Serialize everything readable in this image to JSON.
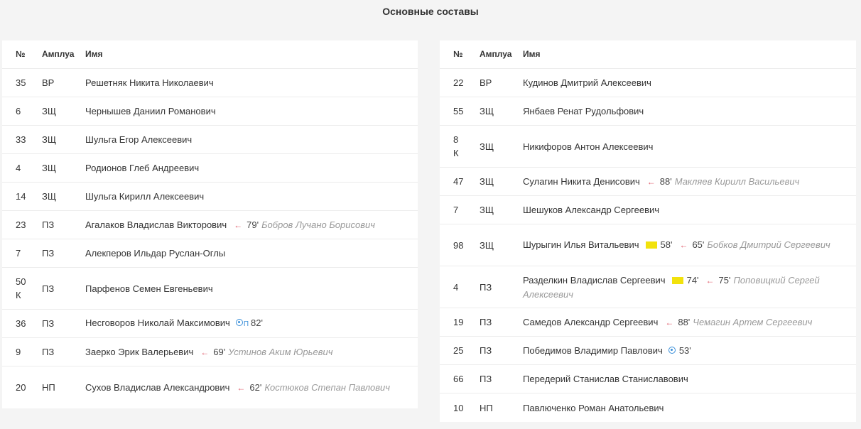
{
  "title": "Основные составы",
  "headers": {
    "num": "№",
    "pos": "Амплуа",
    "name": "Имя"
  },
  "left": [
    {
      "num": "35",
      "pos": "ВР",
      "name": "Решетняк Никита Николаевич"
    },
    {
      "num": "6",
      "pos": "ЗЩ",
      "name": "Чернышев Даниил Романович"
    },
    {
      "num": "33",
      "pos": "ЗЩ",
      "name": "Шульга Егор Алексеевич"
    },
    {
      "num": "4",
      "pos": "ЗЩ",
      "name": "Родионов Глеб Андреевич"
    },
    {
      "num": "14",
      "pos": "ЗЩ",
      "name": "Шульга Кирилл Алексеевич"
    },
    {
      "num": "23",
      "pos": "ПЗ",
      "name": "Агалаков Владислав Викторович",
      "sub_min": "79'",
      "sub_name": "Бобров Лучано Борисович"
    },
    {
      "num": "7",
      "pos": "ПЗ",
      "name": "Алекперов Ильдар Руслан-Оглы"
    },
    {
      "num": "50",
      "captain": "К",
      "pos": "ПЗ",
      "name": "Парфенов Семен Евгеньевич"
    },
    {
      "num": "36",
      "pos": "ПЗ",
      "name": "Несговоров Николай Максимович",
      "goal_tag": "П",
      "goal_min": "82'"
    },
    {
      "num": "9",
      "pos": "ПЗ",
      "name": "Заерко Эрик Валерьевич",
      "sub_min": "69'",
      "sub_name": "Устинов Аким Юрьевич"
    },
    {
      "num": "20",
      "pos": "НП",
      "name": "Сухов Владислав Александрович",
      "sub_min": "62'",
      "sub_name": "Костюков Степан Павлович"
    }
  ],
  "right": [
    {
      "num": "22",
      "pos": "ВР",
      "name": "Кудинов Дмитрий Алексеевич"
    },
    {
      "num": "55",
      "pos": "ЗЩ",
      "name": "Янбаев Ренат Рудольфович"
    },
    {
      "num": "8",
      "captain": "К",
      "pos": "ЗЩ",
      "name": "Никифоров Антон Алексеевич"
    },
    {
      "num": "47",
      "pos": "ЗЩ",
      "name": "Сулагин Никита Денисович",
      "sub_min": "88'",
      "sub_name": "Макляев Кирилл Васильевич"
    },
    {
      "num": "7",
      "pos": "ЗЩ",
      "name": "Шешуков Александр Сергеевич"
    },
    {
      "num": "98",
      "pos": "ЗЩ",
      "name": "Шурыгин Илья Витальевич",
      "yc_min": "58'",
      "sub_min": "65'",
      "sub_name": "Бобков Дмитрий Сергеевич"
    },
    {
      "num": "4",
      "pos": "ПЗ",
      "name": "Разделкин Владислав Сергеевич",
      "yc_min": "74'",
      "sub_min": "75'",
      "sub_name": "Поповицкий Сергей Алексеевич"
    },
    {
      "num": "19",
      "pos": "ПЗ",
      "name": "Самедов Александр Сергеевич",
      "sub_min": "88'",
      "sub_name": "Чемагин Артем Сергеевич"
    },
    {
      "num": "25",
      "pos": "ПЗ",
      "name": "Победимов Владимир Павлович",
      "goal_min": "53'"
    },
    {
      "num": "66",
      "pos": "ПЗ",
      "name": "Передерий Станислав Станиславович"
    },
    {
      "num": "10",
      "pos": "НП",
      "name": "Павлюченко Роман Анатольевич"
    }
  ],
  "colors": {
    "sub_arrow": "#e05c6b",
    "yellow_card": "#f2e20c",
    "goal": "#3a8fd9"
  }
}
